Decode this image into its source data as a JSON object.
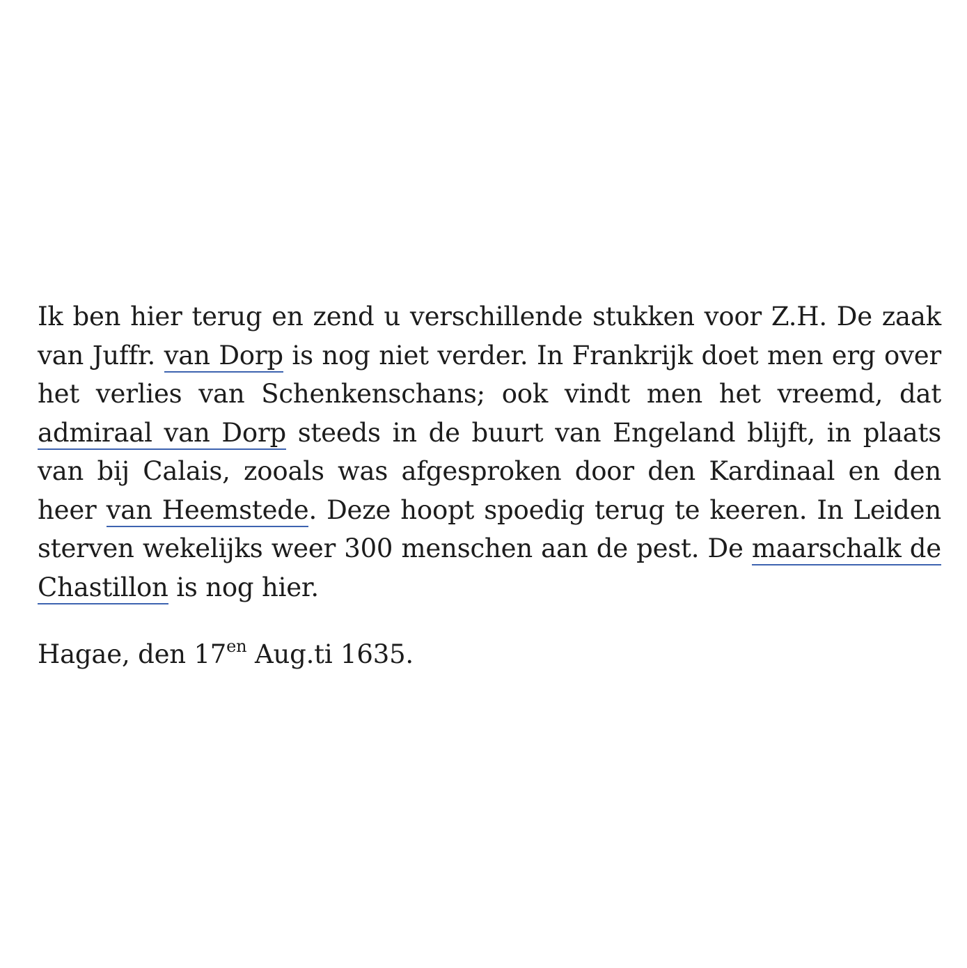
{
  "letter": {
    "seg1": "Ik ben hier terug en zend u verschillende stukken voor Z.H. De zaak van Juffr. ",
    "link1": "van Dorp",
    "seg2": " is nog niet verder. In Frankrijk doet men erg over het verlies van Schenkenschans; ook vindt men het vreemd, dat ",
    "link2": "admiraal van Dorp",
    "seg3": " steeds in de buurt van Engeland blijft, in plaats van bij Calais, zooals was afgesproken door den Kardinaal en den heer ",
    "link3": "van Heemstede",
    "seg4": ". Deze hoopt spoedig terug te keeren. In Leiden sterven wekelijks weer 300 menschen aan de pest. De ",
    "link4": "maarschalk de Chastillon",
    "seg5": " is nog hier."
  },
  "signoff": {
    "place_prefix": "Hagae, den 17",
    "day_suffix": "en",
    "rest": " Aug.ti 1635."
  },
  "colors": {
    "text": "#1c1c1c",
    "link_underline": "#3d63b0",
    "background": "#ffffff"
  }
}
